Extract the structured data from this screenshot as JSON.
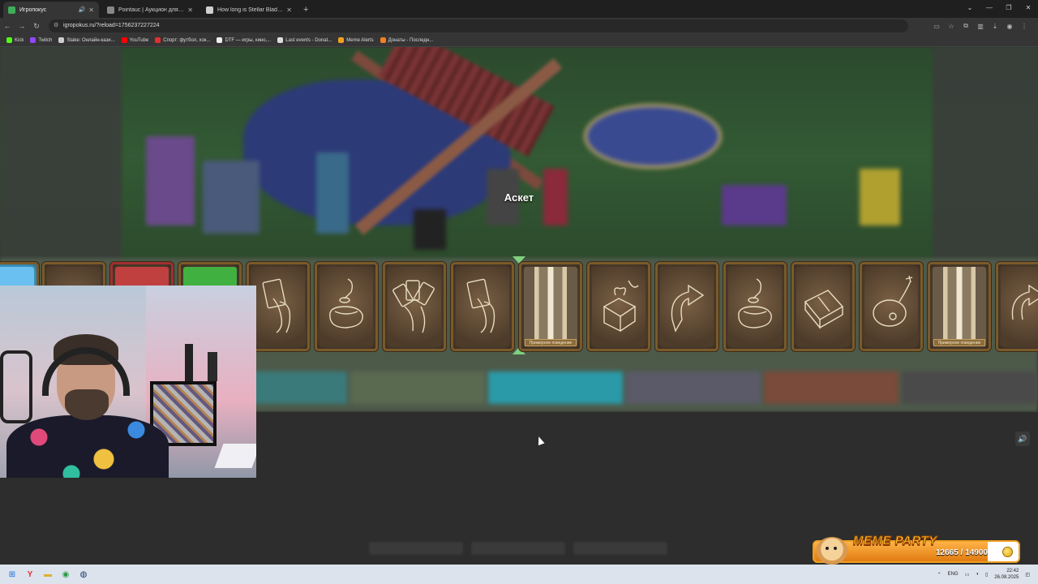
{
  "browser": {
    "tabs": [
      {
        "title": "Игропокус",
        "active": true,
        "audio": true,
        "color": "#3fae5a"
      },
      {
        "title": "Pointauc | Аукцион для стрима",
        "active": false,
        "color": "#888888"
      },
      {
        "title": "How long is Stellar Blade? | How",
        "active": false,
        "color": "#d0d0d0"
      }
    ],
    "new_tab": "+",
    "url": "igropokus.ru/?reload=1756237227224",
    "bookmarks": [
      {
        "label": "Kick",
        "color": "#53fc18"
      },
      {
        "label": "Twitch",
        "color": "#9146ff"
      },
      {
        "label": "Stake: Онлайн-кази...",
        "color": "#cccccc"
      },
      {
        "label": "YouTube",
        "color": "#ff0000"
      },
      {
        "label": "Спорт: футбол, хок...",
        "color": "#e03030"
      },
      {
        "label": "DTF — игры, кино,...",
        "color": "#eeeeee"
      },
      {
        "label": "Last events - Donat...",
        "color": "#dddddd"
      },
      {
        "label": "Meme Alerts",
        "color": "#f0a020"
      },
      {
        "label": "Донаты - Последн...",
        "color": "#f08020"
      }
    ]
  },
  "game": {
    "current_player": "Аскет",
    "cards": [
      {
        "icon": "card-partial",
        "ribbon": ""
      },
      {
        "icon": "card-partial",
        "ribbon": ""
      },
      {
        "icon": "card-partial",
        "ribbon": ""
      },
      {
        "icon": "card-partial",
        "ribbon": ""
      },
      {
        "icon": "hand-card-icon",
        "ribbon": ""
      },
      {
        "icon": "money-bag-icon",
        "ribbon": ""
      },
      {
        "icon": "hand-of-cards-icon",
        "ribbon": ""
      },
      {
        "icon": "hand-card-icon",
        "ribbon": ""
      },
      {
        "icon": "jail-bars-icon",
        "ribbon": "Примерное поведение"
      },
      {
        "icon": "gift-box-icon",
        "ribbon": ""
      },
      {
        "icon": "turn-arrow-icon",
        "ribbon": ""
      },
      {
        "icon": "money-bag-icon",
        "ribbon": ""
      },
      {
        "icon": "cash-stack-icon",
        "ribbon": ""
      },
      {
        "icon": "bomb-icon",
        "ribbon": ""
      },
      {
        "icon": "jail-bars-icon",
        "ribbon": "Примерное поведение"
      },
      {
        "icon": "turn-arrow-icon",
        "ribbon": ""
      }
    ]
  },
  "meme_party": {
    "title": "MEME PARTY",
    "current": 12665,
    "goal": 14900,
    "progress_text": "12665 / 14900",
    "progress_fraction": 0.85
  },
  "taskbar": {
    "lang": "ENG",
    "time": "22:42",
    "date": "26.08.2025"
  }
}
